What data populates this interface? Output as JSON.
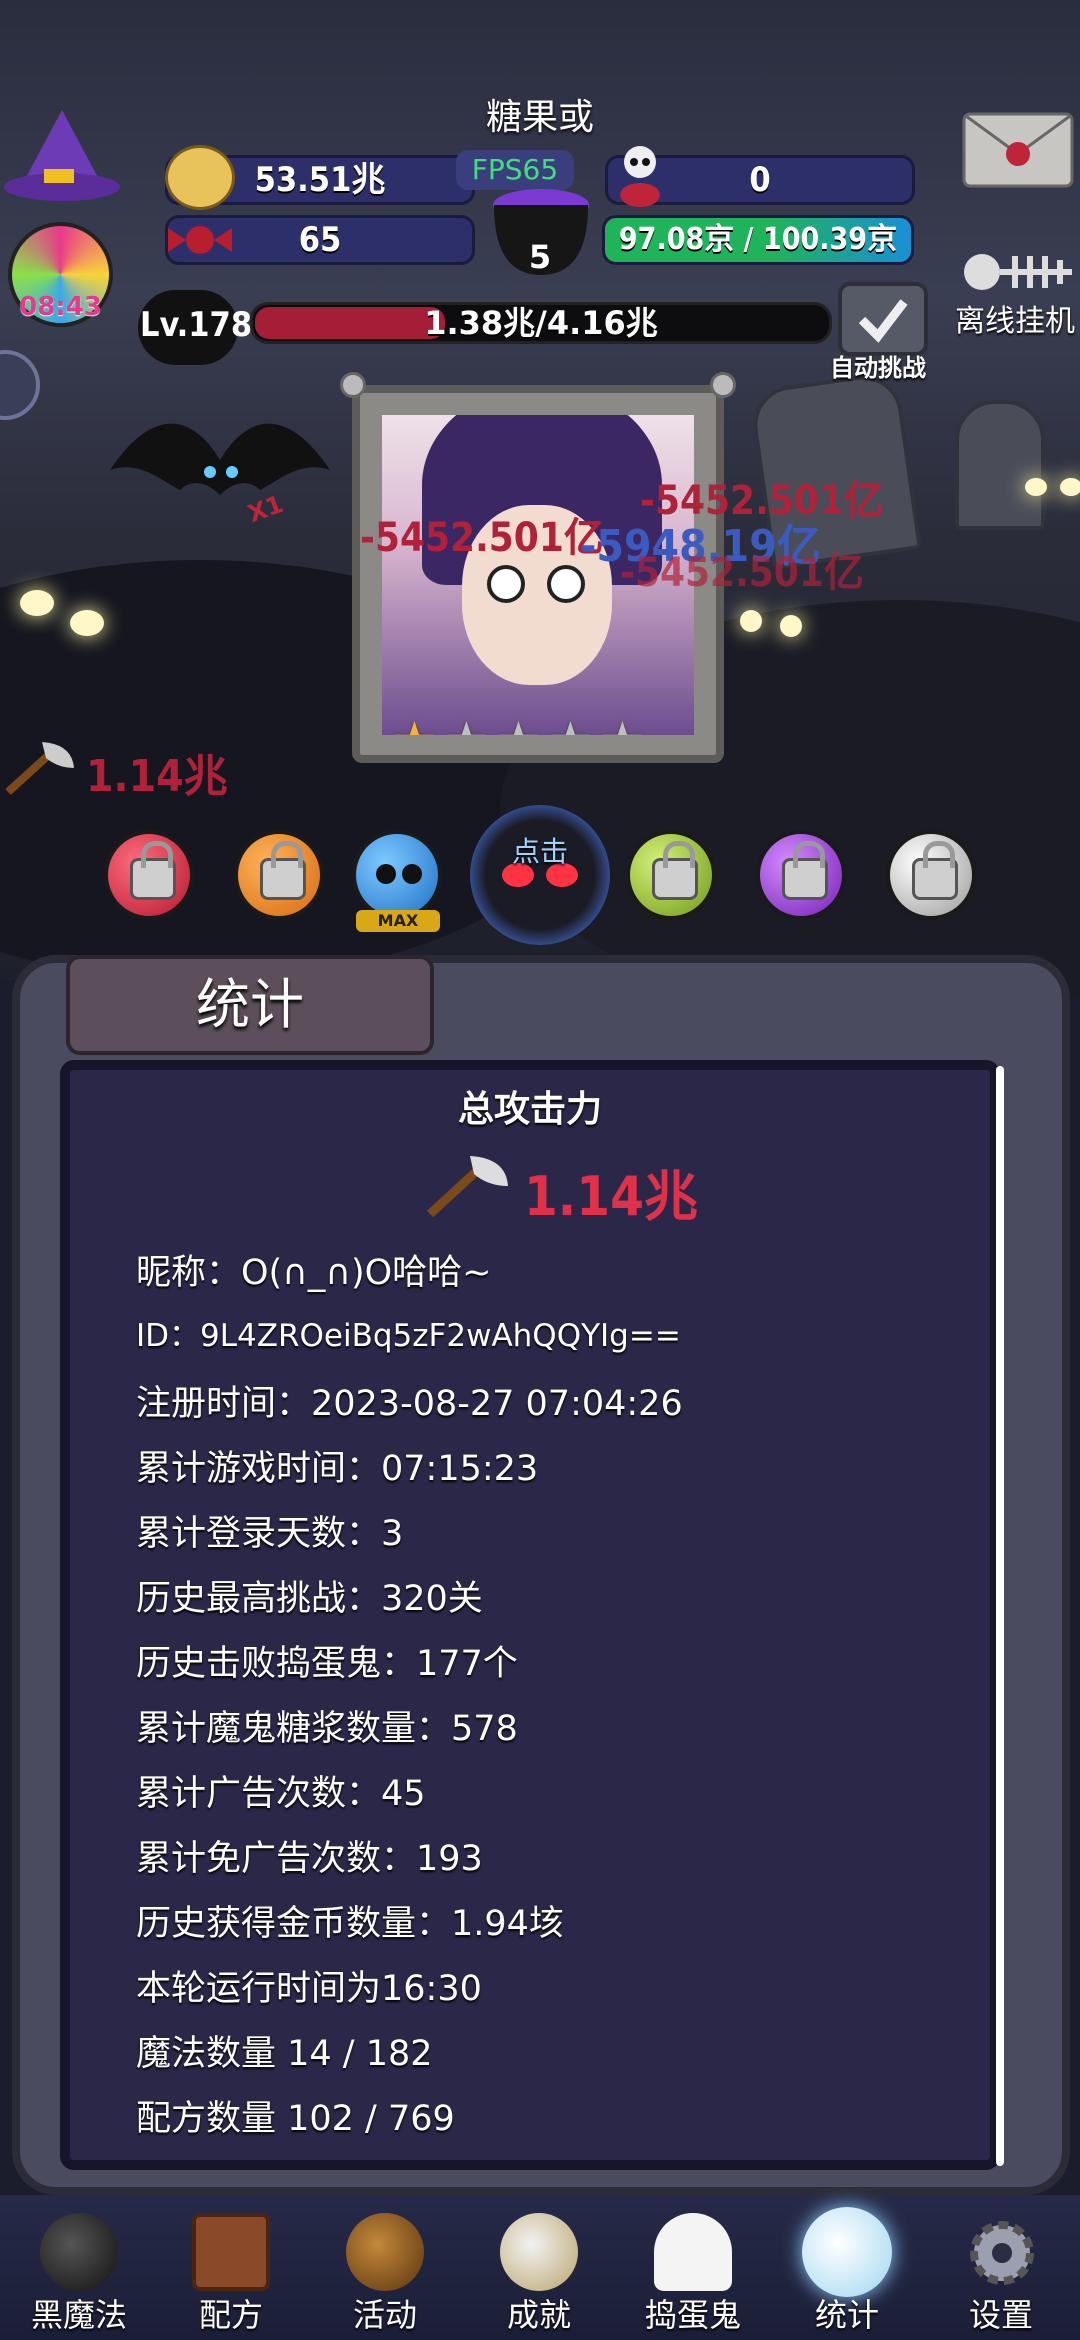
{
  "header": {
    "title": "糖果或",
    "fps": "FPS65",
    "gold": "53.51兆",
    "skull_count": "0",
    "candy": "65",
    "cauldron_count": "5",
    "energy": "97.08京 / 100.39京",
    "level": "Lv.178",
    "xp": "1.38兆/4.16兆",
    "auto_challenge": "自动挑战",
    "offline": "离线挂机",
    "lollipop_timer": "08:43"
  },
  "battle": {
    "damage_numbers": [
      "-5452.501亿",
      "-5452.501亿",
      "-5948.19亿",
      "-5452.501亿"
    ],
    "attack_power": "1.14兆",
    "bat_multiplier": "X1",
    "stars_filled": 1,
    "stars_total": 5,
    "tap_label": "点击",
    "max_label": "MAX"
  },
  "stats": {
    "tab_label": "统计",
    "total_attack_title": "总攻击力",
    "total_attack_value": "1.14兆",
    "lines": [
      "昵称：O(∩_∩)O哈哈~",
      "ID：9L4ZROeiBq5zF2wAhQQYIg==",
      "注册时间：2023-08-27 07:04:26",
      "累计游戏时间：07:15:23",
      "累计登录天数：3",
      "历史最高挑战：320关",
      "历史击败捣蛋鬼：177个",
      "累计魔鬼糖浆数量：578",
      "累计广告次数：45",
      "累计免广告次数：193",
      "历史获得金币数量：1.94垓",
      "本轮运行时间为16:30",
      "魔法数量 14 / 182",
      "配方数量 102 / 769"
    ]
  },
  "nav": [
    {
      "label": "黑魔法"
    },
    {
      "label": "配方"
    },
    {
      "label": "活动"
    },
    {
      "label": "成就"
    },
    {
      "label": "捣蛋鬼"
    },
    {
      "label": "统计"
    },
    {
      "label": "设置"
    }
  ],
  "colors": {
    "damage_red": "#b0223a",
    "damage_blue": "#3b5bbf",
    "attack_red": "#e0304a",
    "energy_green": "#1fb35a",
    "energy_blue": "#1a8fd6"
  }
}
